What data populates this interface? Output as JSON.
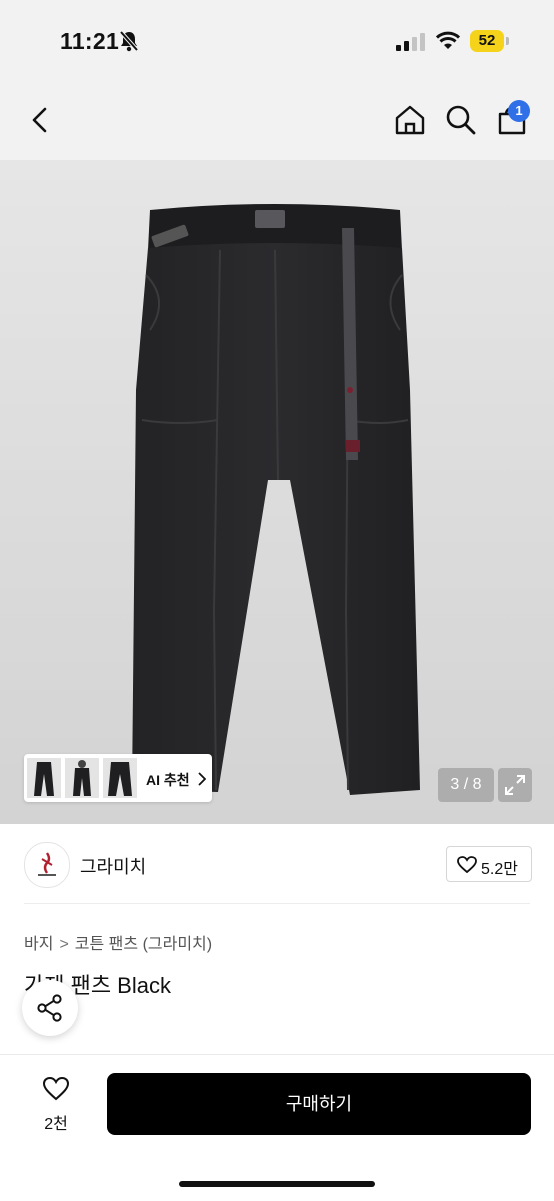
{
  "status_bar": {
    "time": "11:21",
    "battery": "52"
  },
  "nav": {
    "cart_count": "1"
  },
  "gallery": {
    "counter": "3 / 8",
    "ai_label": "AI 추천"
  },
  "seller": {
    "name": "그라미치",
    "likes": "5.2만"
  },
  "product": {
    "breadcrumb": [
      "바지",
      "코튼 팬츠 (그라미치)"
    ],
    "title": "가제 팬츠 Black"
  },
  "bottom": {
    "wish_count": "2천",
    "buy_label": "구매하기"
  },
  "colors": {
    "accent_badge": "#2f6fe8",
    "battery": "#f5d31a",
    "buy_button": "#000000"
  }
}
